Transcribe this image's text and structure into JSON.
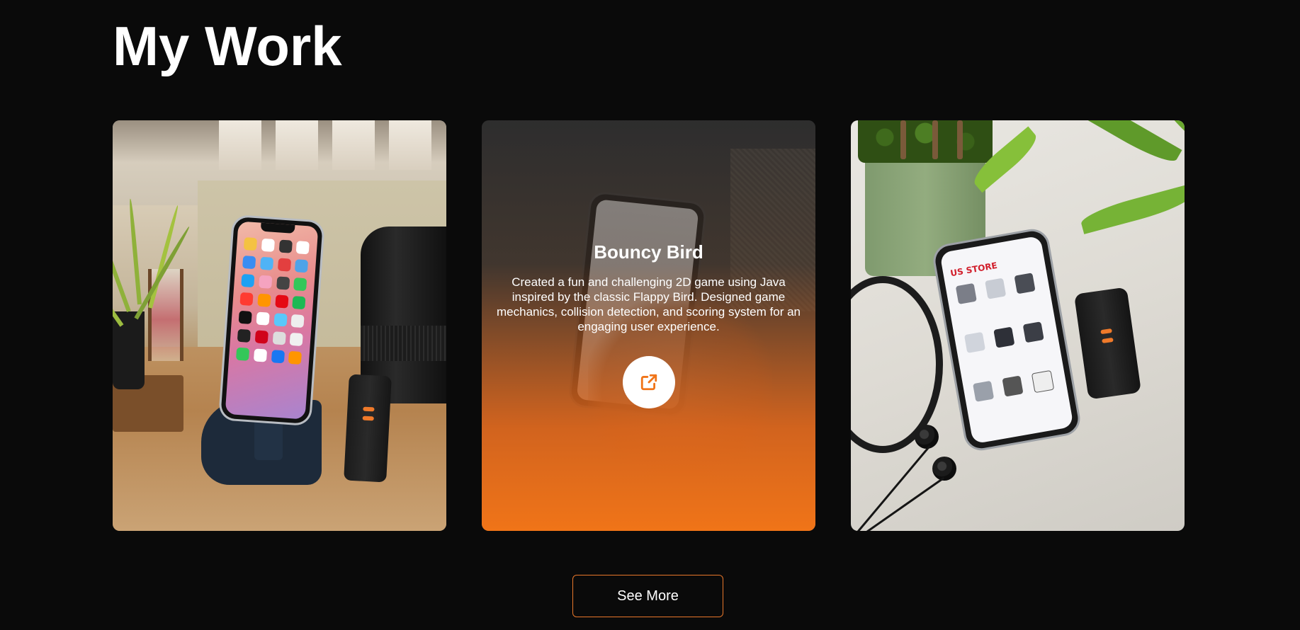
{
  "section": {
    "title": "My Work"
  },
  "projects": [
    {
      "image": "phone-on-stand-desk-photo"
    },
    {
      "image": "hand-holding-phone-photo",
      "title": "Bouncy Bird",
      "description": "Created a fun and challenging 2D game using Java inspired by the classic Flappy Bird. Designed game mechanics, collision detection, and scoring system for an engaging user experience.",
      "link_icon": "external-link-icon"
    },
    {
      "image": "phone-ecommerce-app-photo",
      "screen_logo": "US STORE"
    }
  ],
  "actions": {
    "see_more_label": "See More"
  },
  "colors": {
    "background": "#0a0a0a",
    "accent": "#f07418",
    "text": "#ffffff"
  }
}
